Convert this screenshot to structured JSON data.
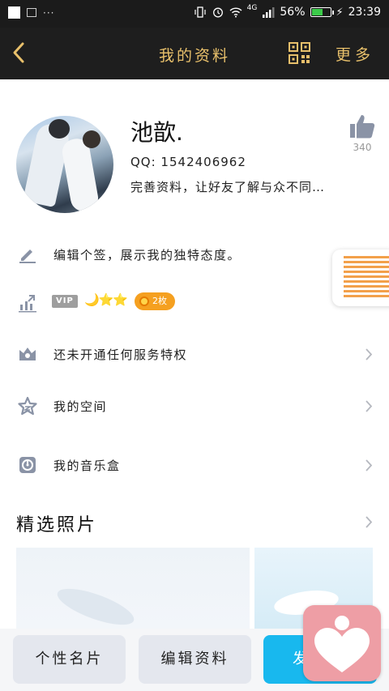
{
  "status_bar": {
    "battery": "56%",
    "network": "4G",
    "time": "23:39",
    "dots": "···"
  },
  "nav": {
    "title": "我的资料",
    "more": "更多"
  },
  "profile": {
    "name": "池歆.",
    "qq": "QQ:  1542406962",
    "bio": "完善资料，让好友了解与众不同…",
    "likes": "340"
  },
  "rows": {
    "signature": "编辑个签，展示我的独特态度。",
    "vip_tag": "VIP",
    "vip_icons": "🌙⭐⭐",
    "vip_badge": "2枚",
    "services": "还未开通任何服务特权",
    "qzone": "我的空间",
    "music": "我的音乐盒"
  },
  "photos": {
    "title": "精选照片"
  },
  "bottom": {
    "card": "个性名片",
    "edit": "编辑资料",
    "send": "发"
  },
  "colors": {
    "nav_bg": "#1e1e1e",
    "accent_gold": "#e8c06b",
    "send_blue": "#18b8ee",
    "vip_orange": "#f5a020",
    "icon_gray": "#8a93a6"
  }
}
